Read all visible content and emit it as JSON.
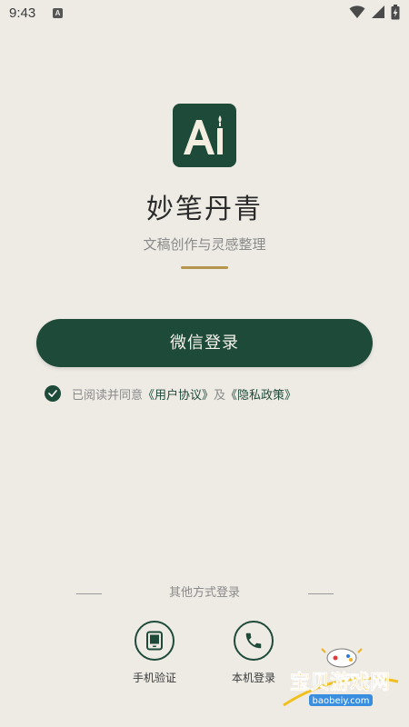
{
  "status_bar": {
    "time": "9:43",
    "notification_icon": "A"
  },
  "logo": {
    "text": "AI",
    "background": "#1E4A3A"
  },
  "app": {
    "title": "妙笔丹青",
    "subtitle": "文稿创作与灵感整理"
  },
  "login": {
    "wechat_label": "微信登录"
  },
  "agreement": {
    "prefix": "已阅读并同意",
    "user_agreement": "《用户协议》",
    "joiner": "及",
    "privacy_policy": "《隐私政策》",
    "checked": true
  },
  "other_login": {
    "heading": "其他方式登录",
    "options": [
      {
        "label": "手机验证",
        "icon": "tablet-icon"
      },
      {
        "label": "本机登录",
        "icon": "phone-icon"
      }
    ]
  },
  "colors": {
    "primary": "#1E4A3A",
    "accent_gold": "#B6964F",
    "background": "#EEEBE5"
  },
  "watermark": {
    "name": "宝贝游戏网",
    "url": "baobeiy.com"
  }
}
